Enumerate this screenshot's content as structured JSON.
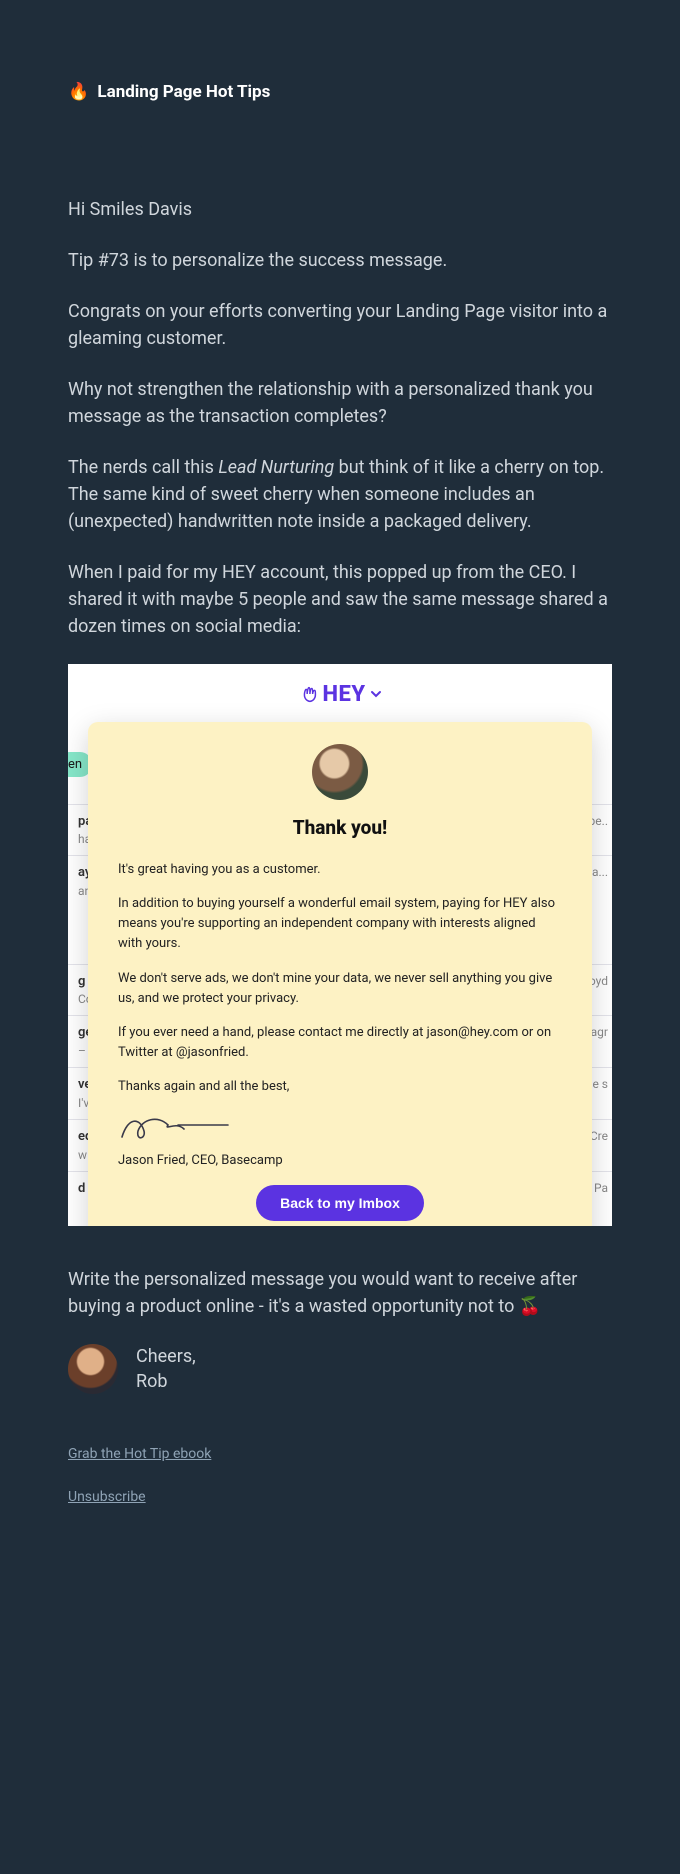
{
  "header": {
    "icon": "🔥",
    "title": "Landing Page Hot Tips"
  },
  "body": {
    "greeting": "Hi Smiles Davis",
    "p1": "Tip #73 is to personalize the success message.",
    "p2": "Congrats on your efforts converting your Landing Page visitor into a gleaming customer.",
    "p3": "Why not strengthen the relationship with a personalized thank you message as the transaction completes?",
    "p4a": "The nerds call this ",
    "p4em": "Lead Nurturing",
    "p4b": " but think of it like a cherry on top. The same kind of sweet cherry when someone includes an (unexpected) handwritten note inside a packaged delivery.",
    "p5": "When I paid for my HEY account, this popped up from the CEO. I shared it with maybe 5 people and saw the same message shared a dozen times on social media:",
    "p6": "Write the personalized message you would want to receive after buying a product online - it's a wasted opportunity not to 🍒"
  },
  "hey": {
    "logo": "HEY",
    "bg_pill": "en",
    "bg": {
      "r1a": "pa",
      "r1b": "han",
      "r1r": "g pe..",
      "r2a": "ayin",
      "r2b": "ank",
      "r2r": "a...",
      "r3a": "g Pa",
      "r3b": "Cod",
      "r3r": "loyd",
      "r4a": "ge",
      "r4r": "aragr",
      "r5a": "ve",
      "r5b": "I've l",
      "r5r": "he s",
      "r6a": "ed /",
      "r6b": "w you",
      "r6r": "t Cre",
      "r7a": "d w",
      "r7r": "e Pa"
    },
    "modal": {
      "title": "Thank you!",
      "p1": "It's great having you as a customer.",
      "p2": "In addition to buying yourself a wonderful email system, paying for HEY also means you're supporting an independent company with interests aligned with yours.",
      "p3": "We don't serve ads, we don't mine your data, we never sell anything you give us, and we protect your privacy.",
      "p4": "If you ever need a hand, please contact me directly at jason@hey.com or on Twitter at @jasonfried.",
      "p5": "Thanks again and all the best,",
      "signature_name": "Jason Fried, CEO, Basecamp",
      "button": "Back to my Imbox"
    }
  },
  "signoff": {
    "cheers": "Cheers,",
    "name": "Rob"
  },
  "footer": {
    "ebook": "Grab the Hot Tip ebook",
    "unsubscribe": "Unsubscribe"
  }
}
